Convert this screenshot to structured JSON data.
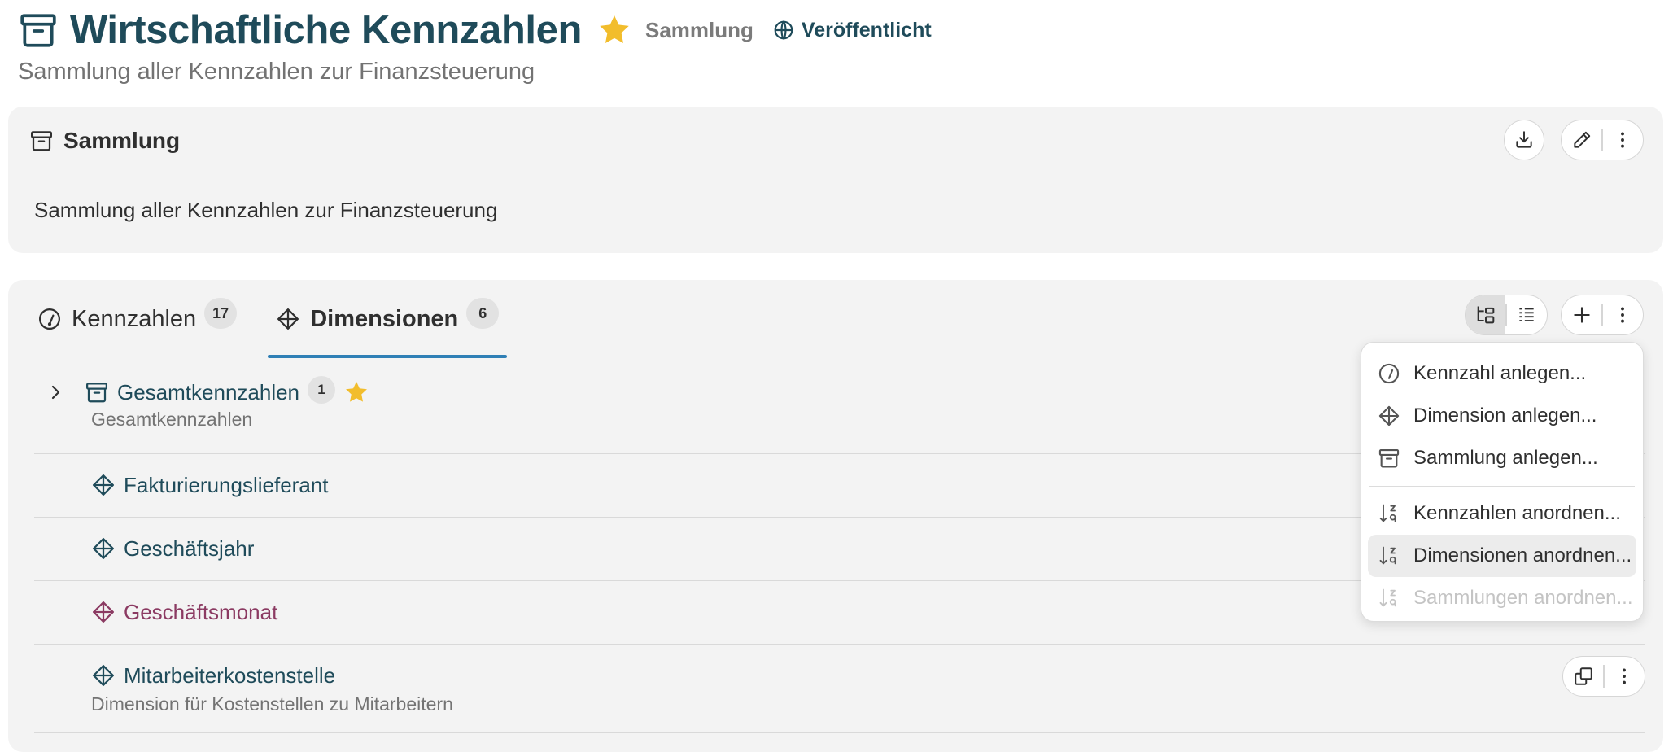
{
  "header": {
    "title": "Wirtschaftliche Kennzahlen",
    "type_label": "Sammlung",
    "status_label": "Veröffentlicht",
    "subtitle": "Sammlung aller Kennzahlen zur Finanzsteuerung",
    "icon": "archive-box-icon",
    "favorite": true
  },
  "collection_card": {
    "title": "Sammlung",
    "description": "Sammlung aller Kennzahlen zur Finanzsteuerung",
    "actions": [
      "download-icon",
      "edit-pencil-icon",
      "more-vertical-icon"
    ]
  },
  "tabs": [
    {
      "label": "Kennzahlen",
      "count": "17",
      "icon": "gauge-icon",
      "active": false
    },
    {
      "label": "Dimensionen",
      "count": "6",
      "icon": "dimension-diamond-icon",
      "active": true
    }
  ],
  "view_toggle": {
    "options": [
      "tree-view-icon",
      "list-view-icon"
    ],
    "selected": "tree-view-icon"
  },
  "tree": {
    "items": [
      {
        "label": "Gesamtkennzahlen",
        "description": "Gesamtkennzahlen",
        "type": "collection",
        "badge": "1",
        "favorite": true,
        "expandable": true
      },
      {
        "label": "Fakturierungslieferant",
        "type": "dimension"
      },
      {
        "label": "Geschäftsjahr",
        "type": "dimension"
      },
      {
        "label": "Geschäftsmonat",
        "type": "dimension",
        "accent": true
      },
      {
        "label": "Mitarbeiterkostenstelle",
        "description": "Dimension für Kostenstellen zu Mitarbeitern",
        "type": "dimension"
      }
    ]
  },
  "menu": {
    "items": [
      {
        "label": "Kennzahl anlegen...",
        "icon": "gauge-icon"
      },
      {
        "label": "Dimension anlegen...",
        "icon": "dimension-diamond-icon"
      },
      {
        "label": "Sammlung anlegen...",
        "icon": "archive-box-icon"
      },
      {
        "label": "Kennzahlen anordnen...",
        "icon": "sort-icon"
      },
      {
        "label": "Dimensionen anordnen...",
        "icon": "sort-icon",
        "highlighted": true
      },
      {
        "label": "Sammlungen anordnen...",
        "icon": "sort-icon",
        "disabled": true
      }
    ]
  },
  "colors": {
    "primary_text": "#1f4b5a",
    "accent_item": "#8b3a62",
    "star": "#f2bd2c",
    "tab_underline": "#2f7fb5",
    "card_bg": "#f3f3f3"
  }
}
